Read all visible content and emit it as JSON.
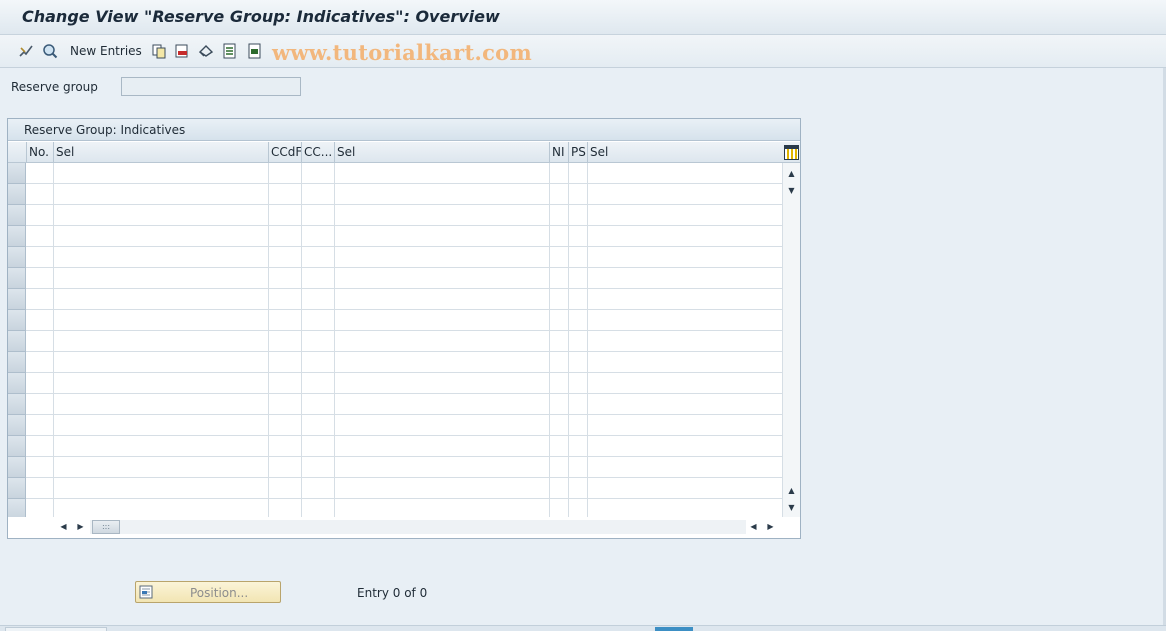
{
  "title": "Change View \"Reserve Group: Indicatives\": Overview",
  "toolbar": {
    "new_entries_label": "New Entries",
    "watermark": "www.tutorialkart.com",
    "icons": [
      "display-change-icon",
      "details-icon",
      "copy-icon",
      "delete-icon",
      "undo-icon",
      "select-all-icon",
      "select-block-icon"
    ]
  },
  "reserve_group": {
    "label": "Reserve group",
    "value": ""
  },
  "table": {
    "title": "Reserve Group: Indicatives",
    "columns": [
      "No.",
      "Sel",
      "CCdF",
      "CC...",
      "Sel",
      "NI",
      "PS",
      "Sel"
    ],
    "rows": []
  },
  "footer": {
    "position_label": "Position...",
    "entry_status": "Entry 0 of 0"
  },
  "colors": {
    "watermark": "#f2b77d",
    "background": "#e8eff5",
    "position_button": "#f6ecc4"
  }
}
